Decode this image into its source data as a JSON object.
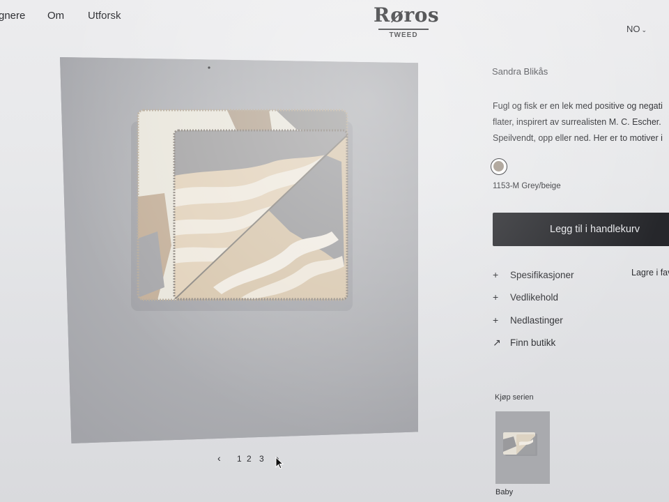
{
  "nav": {
    "designers": "gnere",
    "about": "Om",
    "explore": "Utforsk"
  },
  "logo": {
    "name": "Røros",
    "sub": "TWEED"
  },
  "language": {
    "code": "NO",
    "chevron": "chevron-down-icon"
  },
  "gallery": {
    "prev_icon": "chevron-left-icon",
    "pages": [
      "1",
      "2",
      "3"
    ],
    "next_icon": "chevron-right-icon"
  },
  "product": {
    "designer": "Sandra Blikås",
    "description_lines": [
      "Fugl og fisk er en lek med positive og negati",
      "flater, inspirert av surrealisten M. C. Escher.",
      "Speilvendt, opp eller ned. Her er to motiver i"
    ],
    "swatch_color": "#a1968a",
    "swatch_label": "1153-M Grey/beige",
    "add_to_cart": "Legg til i handlekurv",
    "save_favorite": "Lagre i fav",
    "accordion": [
      {
        "icon": "plus-icon",
        "symbol": "+",
        "label": "Spesifikasjoner"
      },
      {
        "icon": "plus-icon",
        "symbol": "+",
        "label": "Vedlikehold"
      },
      {
        "icon": "plus-icon",
        "symbol": "+",
        "label": "Nedlastinger"
      },
      {
        "icon": "arrow-up-right-icon",
        "symbol": "↗",
        "label": "Finn butikk"
      }
    ]
  },
  "series": {
    "heading": "Kjøp serien",
    "items": [
      {
        "name": "Baby"
      }
    ]
  },
  "colors": {
    "button_dark": "#26272b",
    "background": "#e7e8ea"
  }
}
